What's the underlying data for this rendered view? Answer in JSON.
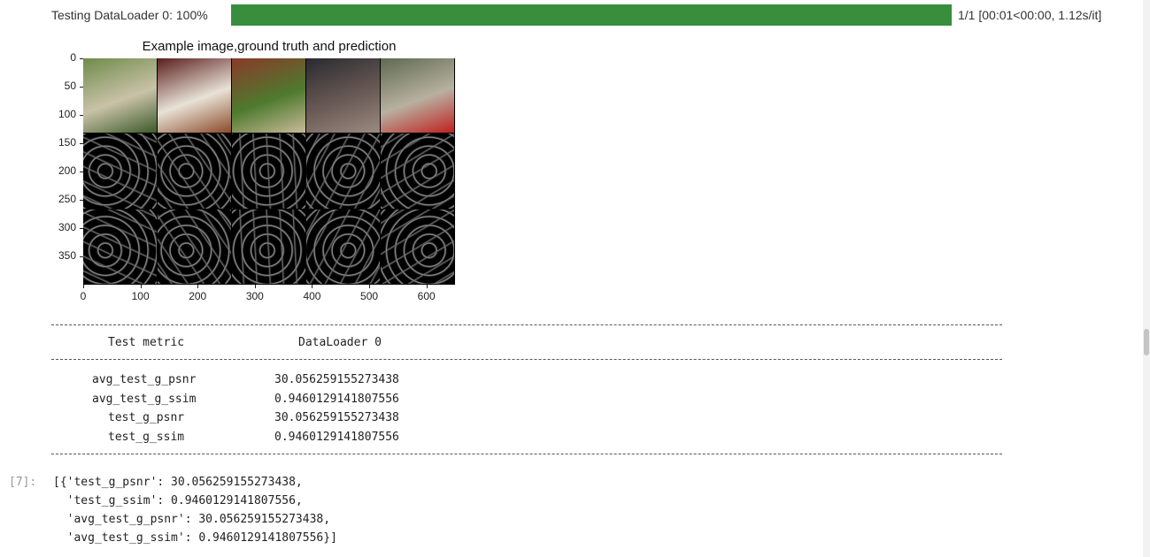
{
  "progress": {
    "label": "Testing DataLoader 0: 100%",
    "fraction": 1.0,
    "stats": "1/1 [00:01<00:00,  1.12s/it]",
    "fill_color": "#388e3c"
  },
  "figure": {
    "title": "Example image,ground truth and prediction",
    "y_ticks": [
      "0",
      "50",
      "100",
      "150",
      "200",
      "250",
      "300",
      "350"
    ],
    "x_ticks": [
      "0",
      "100",
      "200",
      "300",
      "400",
      "500",
      "600"
    ],
    "chart_data": {
      "type": "image-grid",
      "rows": 3,
      "cols": 5,
      "xlim": [
        0,
        650
      ],
      "ylim": [
        400,
        0
      ],
      "row_content": [
        "images",
        "ground truth edges",
        "prediction edges"
      ]
    }
  },
  "metrics": {
    "header_metric": "Test metric",
    "header_loader": "DataLoader 0",
    "rows": [
      {
        "name": "avg_test_g_psnr",
        "value": "30.056259155273438"
      },
      {
        "name": "avg_test_g_ssim",
        "value": "0.9460129141807556"
      },
      {
        "name": "test_g_psnr",
        "value": "30.056259155273438"
      },
      {
        "name": "test_g_ssim",
        "value": "0.9460129141807556"
      }
    ]
  },
  "output": {
    "prompt": "[7]:",
    "lines": [
      "[{'test_g_psnr': 30.056259155273438,",
      "  'test_g_ssim': 0.9460129141807556,",
      "  'avg_test_g_psnr': 30.056259155273438,",
      "  'avg_test_g_ssim': 0.9460129141807556}]"
    ]
  }
}
